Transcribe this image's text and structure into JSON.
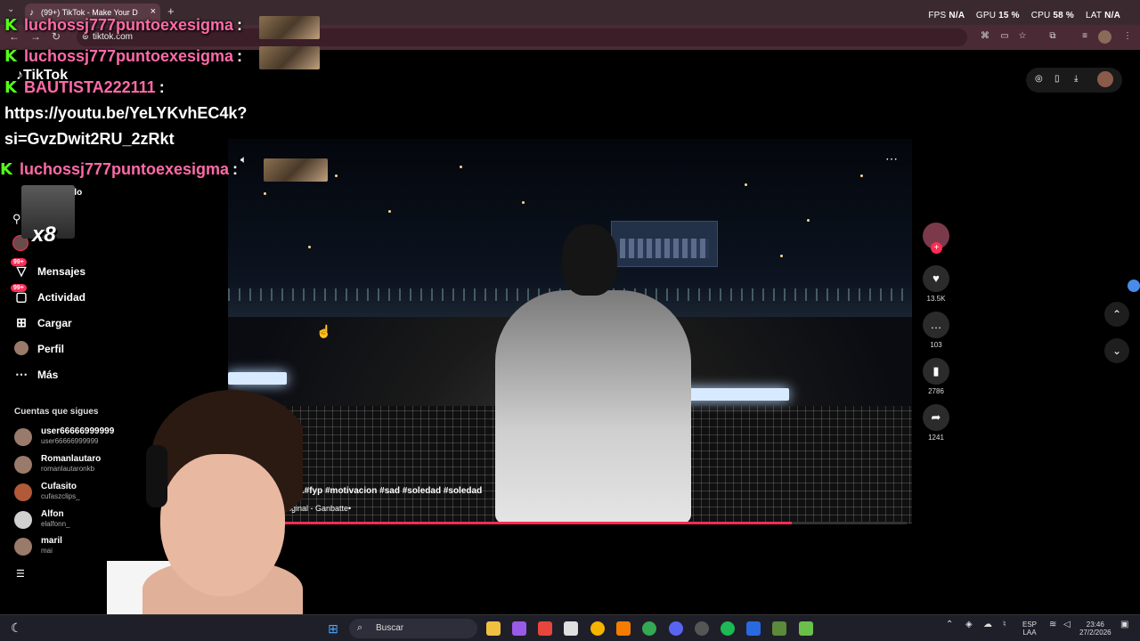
{
  "browser": {
    "tab_title": "(99+) TikTok - Make Your D",
    "tab_close": "×",
    "new_tab": "+",
    "url": "tiktok.com"
  },
  "perf": {
    "fps_label": "FPS",
    "fps_value": "N/A",
    "gpu_label": "GPU",
    "gpu_value": "15 %",
    "cpu_label": "CPU",
    "cpu_value": "58 %",
    "lat_label": "LAT",
    "lat_value": "N/A"
  },
  "tiktok": {
    "logo": "TikTok"
  },
  "chat": [
    {
      "user": "luchossj777puntoexesigma",
      "text": ""
    },
    {
      "user": "luchossj777puntoexesigma",
      "text": ""
    },
    {
      "user": "BAUTISTA222111",
      "text": ""
    },
    {
      "user": "luchossj777puntoexesigma",
      "text": ""
    }
  ],
  "chat_link_line1": "https://youtu.be/YeLYKvhEC4k?",
  "chat_link_line2": "si=GvzDwit2RU_2zRkt",
  "chat_colon": ":",
  "chat_badge": "K",
  "x8": "x8",
  "sidebar": {
    "items": [
      {
        "label": "Mensajes",
        "badge": "99+",
        "icon": "inbox-icon"
      },
      {
        "label": "Actividad",
        "badge": "99+",
        "icon": "activity-icon"
      },
      {
        "label": "Cargar",
        "badge": "",
        "icon": "upload-icon"
      },
      {
        "label": "Perfil",
        "badge": "",
        "icon": "profile-icon"
      },
      {
        "label": "Más",
        "badge": "",
        "icon": "more-icon"
      }
    ],
    "partial_label": "do",
    "following_header": "Cuentas que sigues",
    "following": [
      {
        "name": "user66666999999",
        "handle": "user66666999999"
      },
      {
        "name": "Romanlautaro",
        "handle": "romanlautaronkb"
      },
      {
        "name": "Cufasito",
        "handle": "cufaszclips_"
      },
      {
        "name": "Alfon",
        "handle": "elalfonn_"
      },
      {
        "name": "maril",
        "handle": "mai"
      }
    ]
  },
  "video": {
    "caption": "do?...#fyp #motivacion #sad #soledad #soledad",
    "sound": "original - Ganbatte•",
    "progress": 0.82
  },
  "actions": {
    "likes": "13.5K",
    "comments": "103",
    "saves": "2786",
    "shares": "1241"
  },
  "taskbar": {
    "search_placeholder": "Buscar",
    "lang_line1": "ESP",
    "lang_line2": "LAA",
    "time": "23:46",
    "date": "27/2/2026"
  }
}
